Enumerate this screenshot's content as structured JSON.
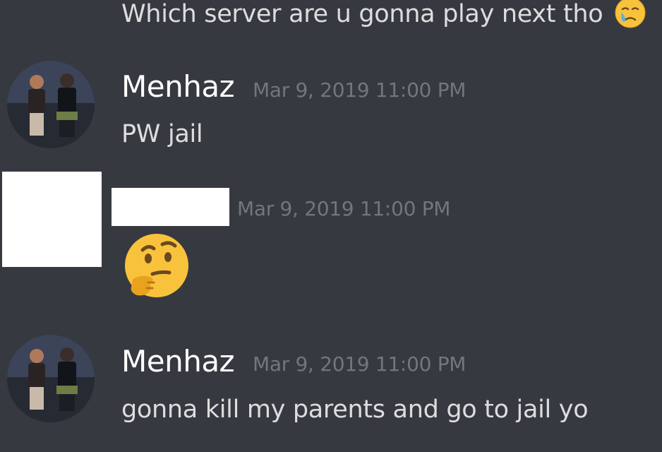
{
  "messages": [
    {
      "continuation_text": "Which server are u gonna play next tho",
      "emoji": "crying-face-icon"
    },
    {
      "username": "Menhaz",
      "timestamp": "Mar 9, 2019 11:00 PM",
      "text": "PW jail"
    },
    {
      "username": "",
      "username_redacted": true,
      "timestamp": "Mar 9, 2019 11:00 PM",
      "emoji": "thinking-face-icon"
    },
    {
      "username": "Menhaz",
      "timestamp": "Mar 9, 2019 11:00 PM",
      "text": "gonna kill my parents and go to jail yo"
    }
  ],
  "colors": {
    "background": "#36393f",
    "text": "#dcddde",
    "username": "#ffffff",
    "timestamp": "#72767d",
    "redaction": "#ffffff"
  }
}
